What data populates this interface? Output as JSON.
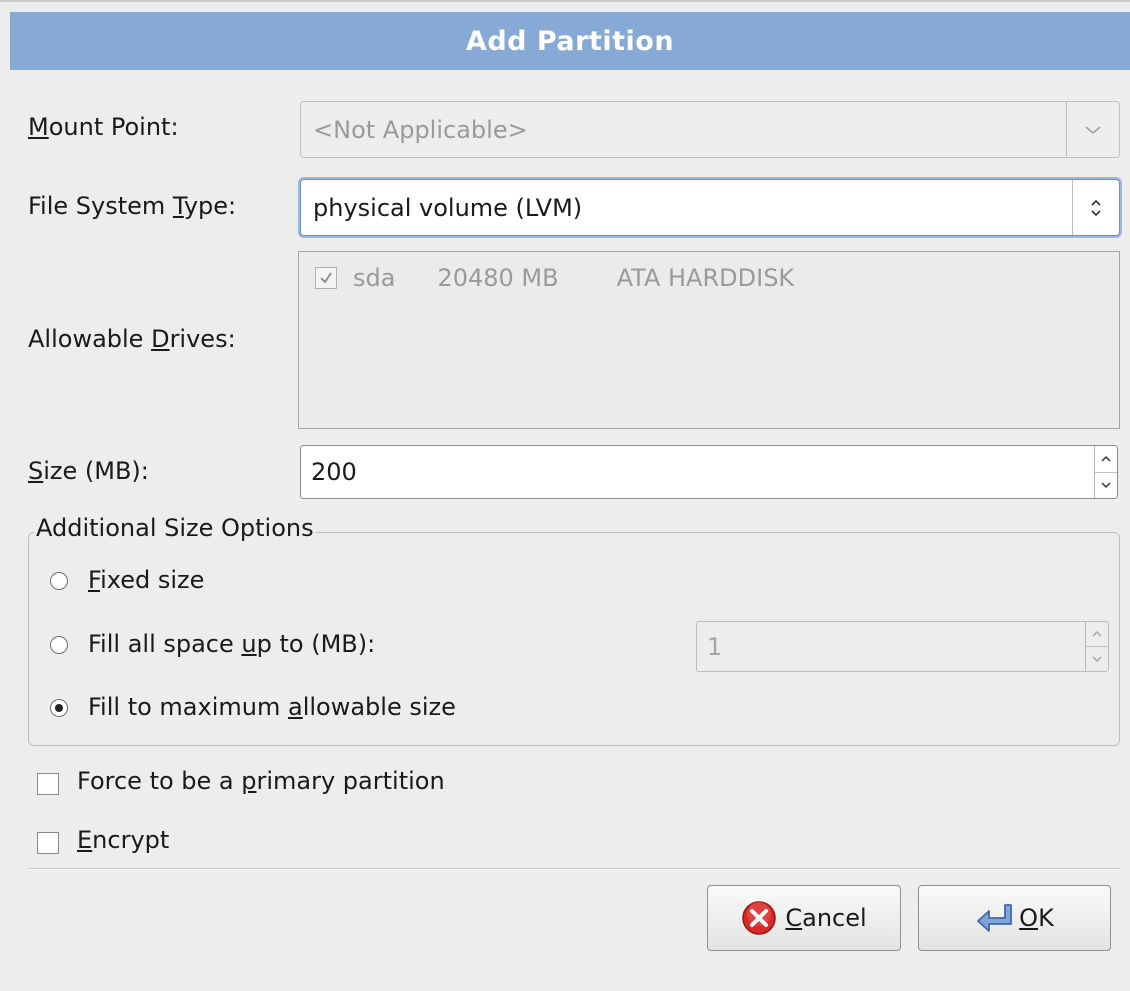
{
  "dialog": {
    "title": "Add Partition"
  },
  "mount_point": {
    "label_prefix": "",
    "label_mnemonic": "M",
    "label_rest": "ount Point:",
    "value": "<Not Applicable>"
  },
  "fs_type": {
    "label_prefix": "File System ",
    "label_mnemonic": "T",
    "label_rest": "ype:",
    "value": "physical volume (LVM)"
  },
  "drives": {
    "label_prefix": "Allowable ",
    "label_mnemonic": "D",
    "label_rest": "rives:",
    "rows": [
      {
        "name": "sda",
        "size": "20480 MB",
        "model": "ATA HARDDISK",
        "checked": true
      }
    ]
  },
  "size": {
    "label_mnemonic": "S",
    "label_rest": "ize (MB):",
    "value": "200"
  },
  "size_options": {
    "title": "Additional Size Options",
    "fixed": {
      "mnemonic": "F",
      "rest": "ixed size",
      "selected": false
    },
    "fill_upto": {
      "prefix": "Fill all space ",
      "mnemonic": "u",
      "rest": "p to (MB):",
      "selected": false,
      "value": "1"
    },
    "fill_max": {
      "prefix": "Fill to maximum ",
      "mnemonic": "a",
      "rest": "llowable size",
      "selected": true
    }
  },
  "primary": {
    "prefix": "Force to be a ",
    "mnemonic": "p",
    "rest": "rimary partition",
    "checked": false
  },
  "encrypt": {
    "mnemonic": "E",
    "rest": "ncrypt",
    "checked": false
  },
  "buttons": {
    "cancel": {
      "mnemonic": "C",
      "rest": "ancel"
    },
    "ok": {
      "mnemonic": "O",
      "rest": "K"
    }
  },
  "colors": {
    "titlebar": "#86a9d6",
    "cancel_icon": "#d42a2a",
    "ok_icon": "#5b84c4"
  },
  "icons": {
    "cancel": "cancel-icon",
    "ok": "ok-enter-icon"
  }
}
